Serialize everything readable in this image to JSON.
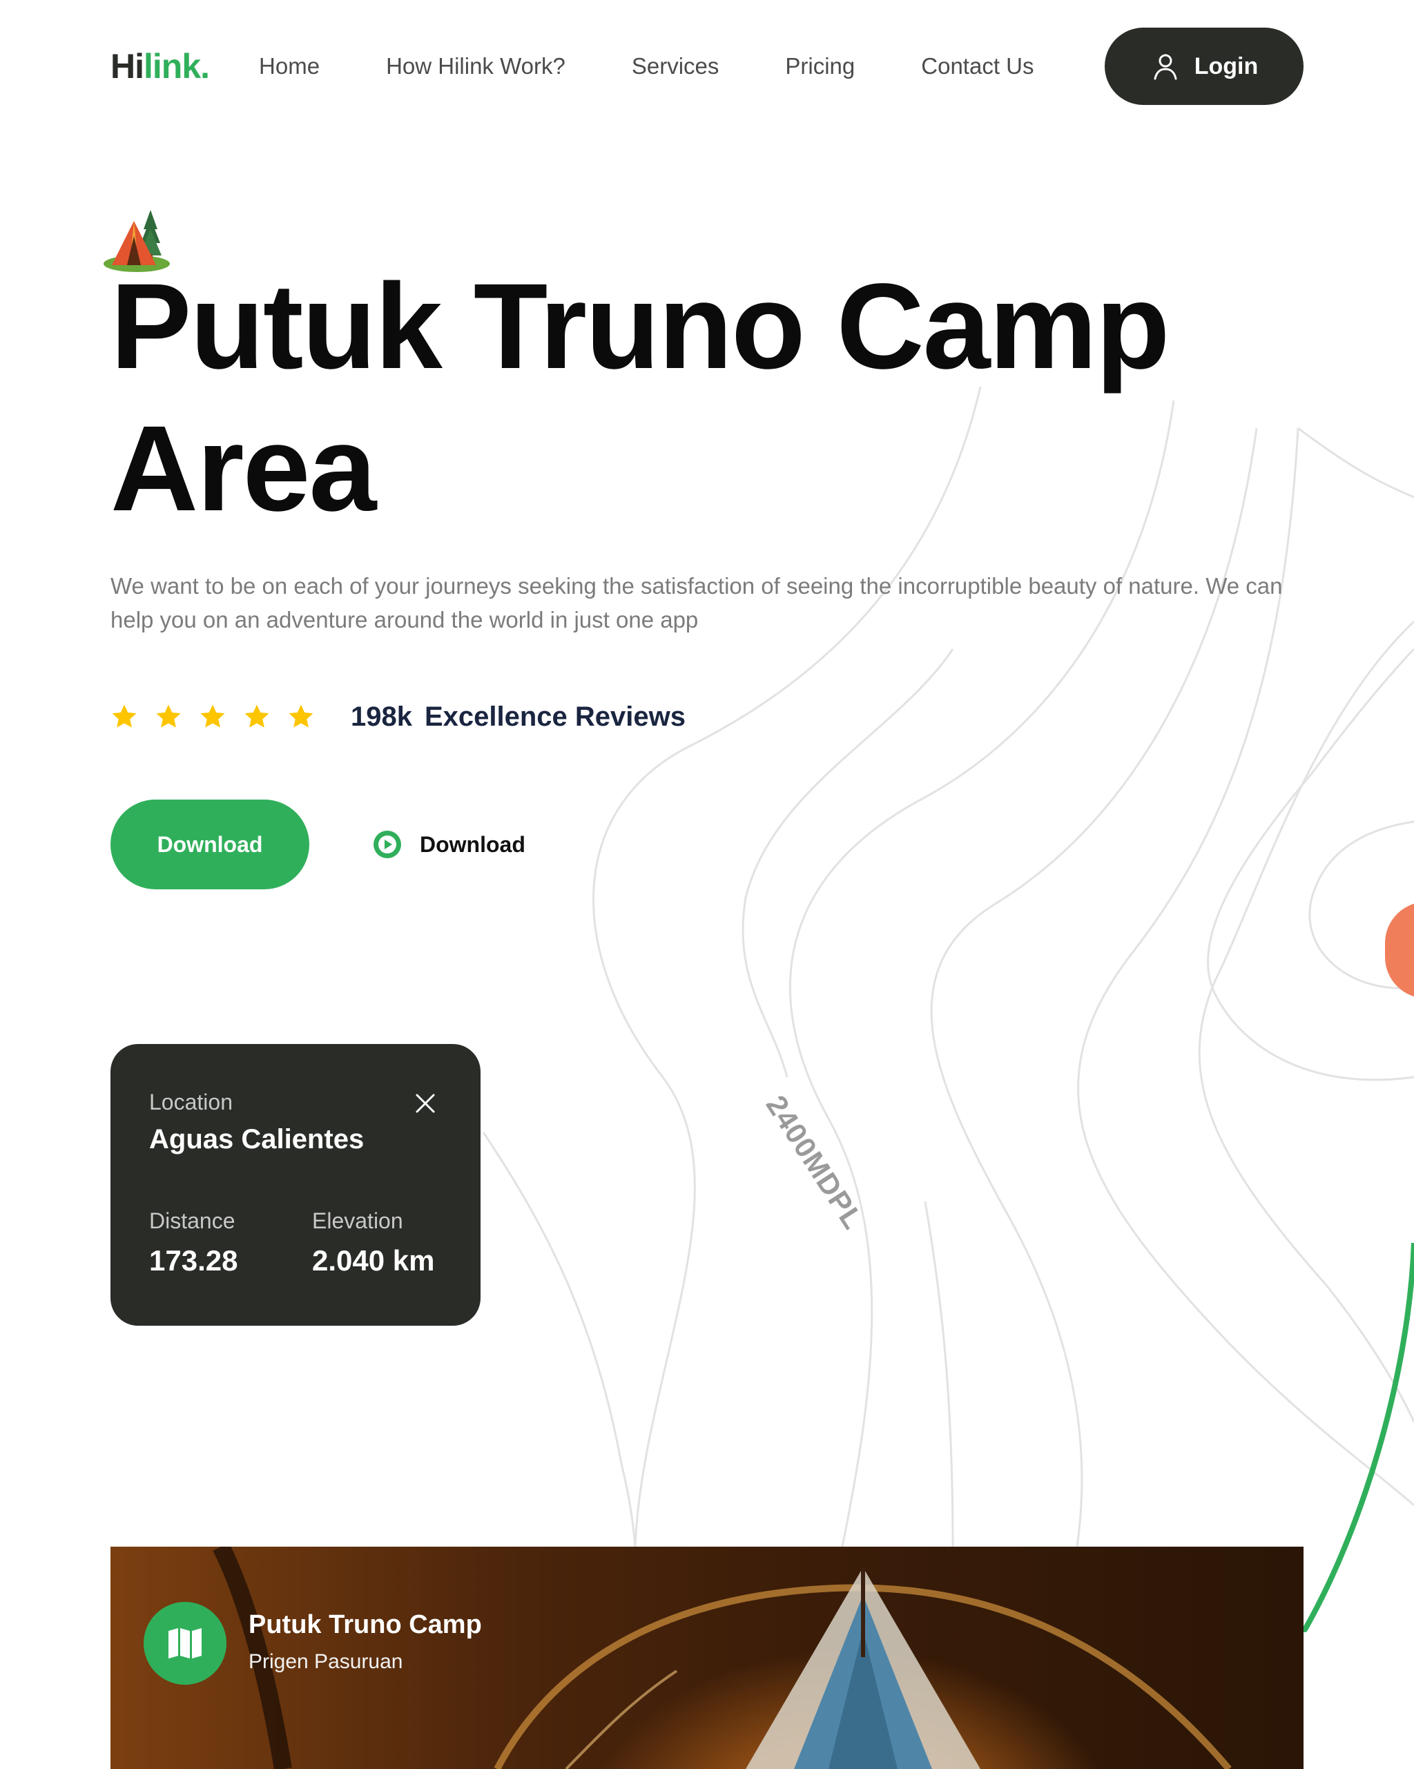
{
  "nav": {
    "logo_dark": "Hi",
    "logo_accent": "link.",
    "links": [
      "Home",
      "How Hilink Work?",
      "Services",
      "Pricing",
      "Contact Us"
    ],
    "login_label": "Login"
  },
  "hero": {
    "title": "Putuk Truno Camp Area",
    "description": "We want to be on each of your journeys seeking the satisfaction of seeing the incorruptible beauty of nature. We can help you on an adventure around the world in just one app",
    "rating": {
      "stars": 5,
      "count": "198k",
      "label": "Excellence Reviews"
    },
    "primary_button": "Download",
    "secondary_button": "Download"
  },
  "location_card": {
    "location_label": "Location",
    "location_value": "Aguas Calientes",
    "distance_label": "Distance",
    "distance_value": "173.28",
    "elevation_label": "Elevation",
    "elevation_value": "2.040 km"
  },
  "contour_label": "2400MDPL",
  "banner": {
    "title": "Putuk Truno Camp",
    "subtitle": "Prigen Pasuruan"
  },
  "colors": {
    "brand_green": "#30af5b",
    "dark": "#292c27",
    "star": "#fdc500",
    "marker": "#f07e5a"
  }
}
